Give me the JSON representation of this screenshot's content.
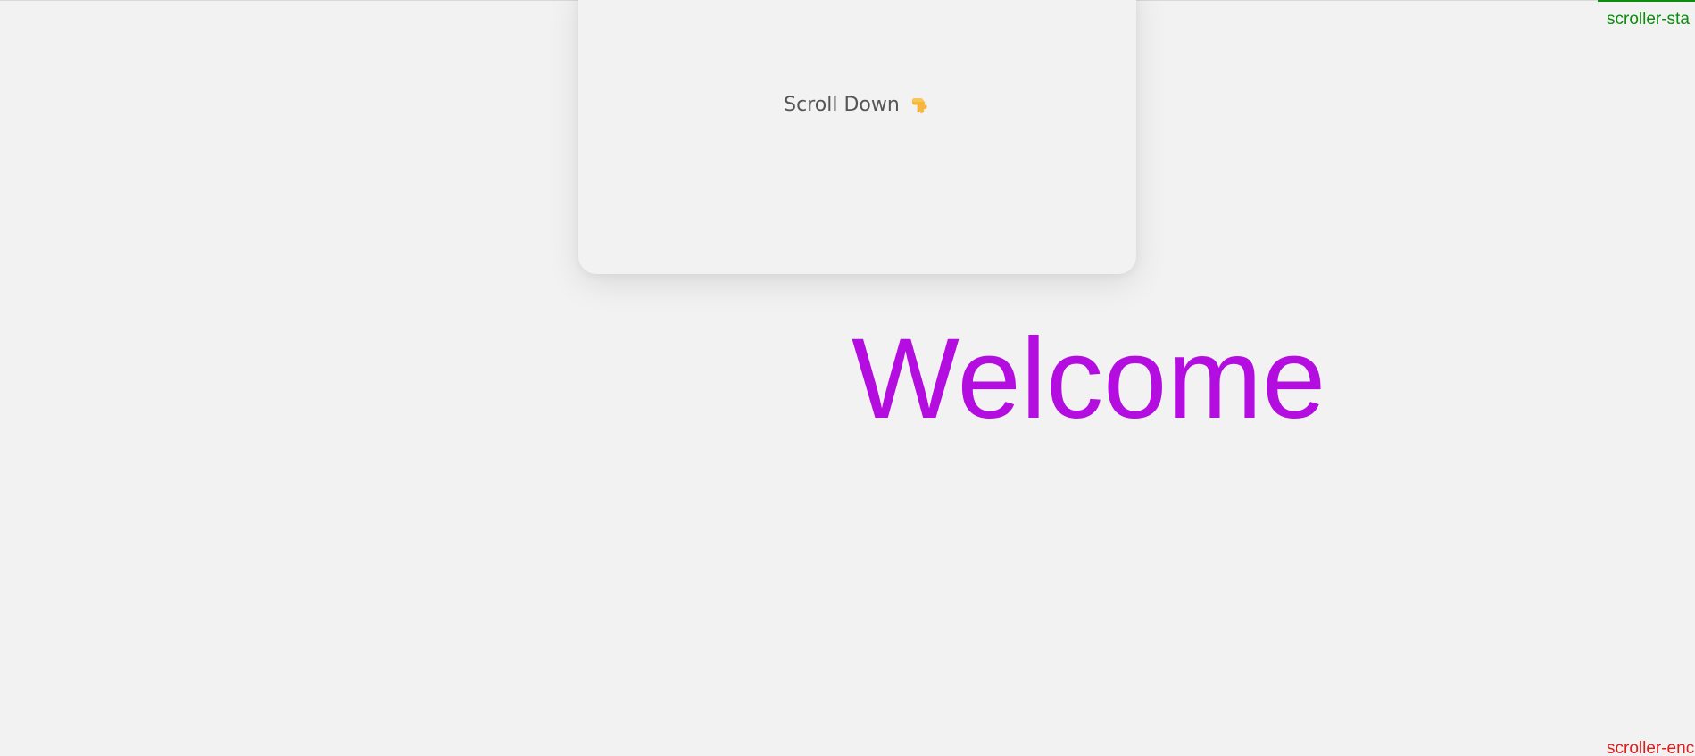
{
  "card": {
    "hint_text": "Scroll Down",
    "hint_icon": "point-down-icon"
  },
  "hero": {
    "title": "Welcome",
    "color": "#b30de0"
  },
  "markers": {
    "start_label": "scroller-sta",
    "end_label": "scroller-enc",
    "start_color": "#0d8c0d",
    "end_color": "#e01b1b"
  }
}
